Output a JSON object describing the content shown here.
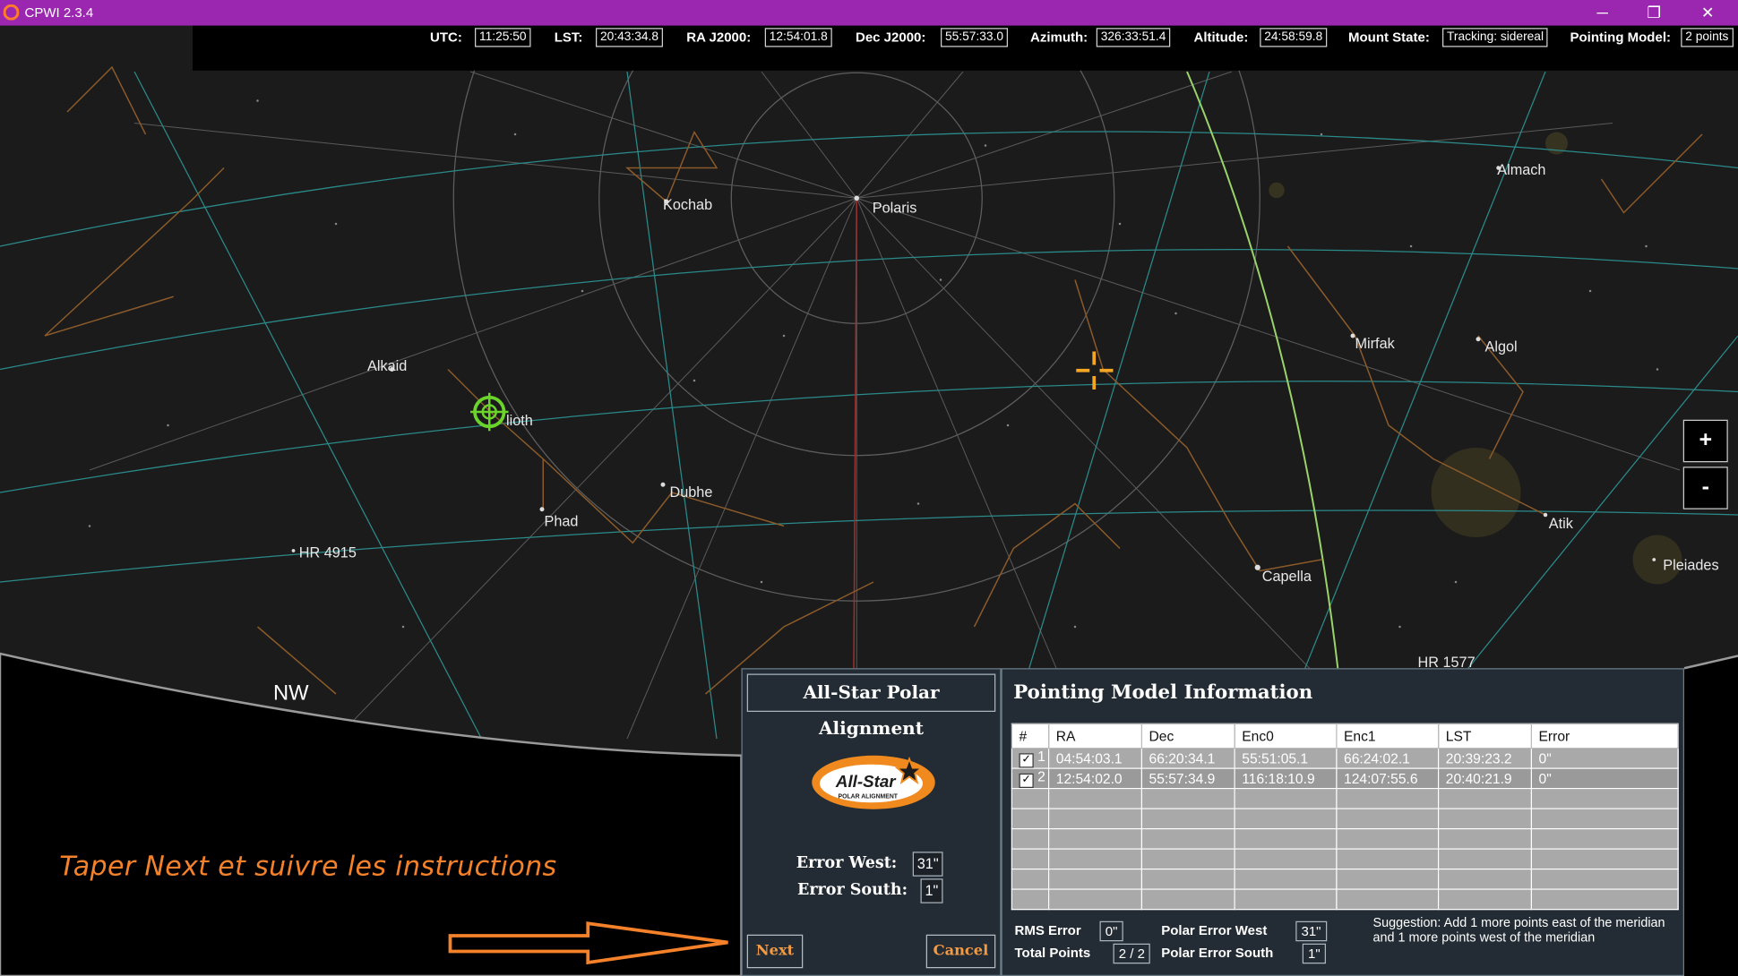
{
  "window": {
    "title": "CPWI 2.3.4",
    "minimize": "─",
    "restore": "❐",
    "close": "✕"
  },
  "status": {
    "utc_label": "UTC:",
    "utc": "11:25:50",
    "lst_label": "LST:",
    "lst": "20:43:34.8",
    "ra_label": "RA J2000:",
    "ra": "12:54:01.8",
    "dec_label": "Dec J2000:",
    "dec": "55:57:33.0",
    "az_label": "Azimuth:",
    "az": "326:33:51.4",
    "alt_label": "Altitude:",
    "alt": "24:58:59.8",
    "mount_label": "Mount State:",
    "mount": "Tracking: sidereal",
    "model_label": "Pointing Model:",
    "model": "2 points"
  },
  "sky": {
    "labels": {
      "kochab": "Kochab",
      "polaris": "Polaris",
      "almach": "Almach",
      "alkaid": "Alkaid",
      "alioth": "lioth",
      "mirfak": "Mirfak",
      "algol": "Algol",
      "dubhe": "Dubhe",
      "phad": "Phad",
      "hr4915": "HR 4915",
      "atik": "Atik",
      "pleiades": "Pleiades",
      "capella": "Capella",
      "hr1577": "HR 1577"
    },
    "direction": "NW",
    "zoom_in": "+",
    "zoom_out": "-"
  },
  "instruction": "Taper Next et suivre les instructions",
  "polar_alignment": {
    "title": "All-Star Polar Alignment",
    "logo_text": "All-Star",
    "logo_sub": "POLAR ALIGNMENT",
    "error_west_label": "Error West:",
    "error_west": "31\"",
    "error_south_label": "Error South:",
    "error_south": "1\"",
    "next": "Next",
    "cancel": "Cancel"
  },
  "pointing_model": {
    "title": "Pointing Model Information",
    "columns": [
      "#",
      "RA",
      "Dec",
      "Enc0",
      "Enc1",
      "LST",
      "Error"
    ],
    "rows": [
      {
        "num": "1",
        "ra": "04:54:03.1",
        "dec": "66:20:34.1",
        "enc0": "55:51:05.1",
        "enc1": "66:24:02.1",
        "lst": "20:39:23.2",
        "error": "0\""
      },
      {
        "num": "2",
        "ra": "12:54:02.0",
        "dec": "55:57:34.9",
        "enc0": "116:18:10.9",
        "enc1": "124:07:55.6",
        "lst": "20:40:21.9",
        "error": "0\""
      }
    ],
    "rms_label": "RMS Error",
    "rms": "0\"",
    "total_label": "Total Points",
    "total": "2 / 2",
    "pew_label": "Polar Error West",
    "pew": "31\"",
    "pes_label": "Polar Error South",
    "pes": "1\"",
    "suggestion": "Suggestion: Add 1 more points east of the meridian and 1 more points west of the meridian"
  }
}
